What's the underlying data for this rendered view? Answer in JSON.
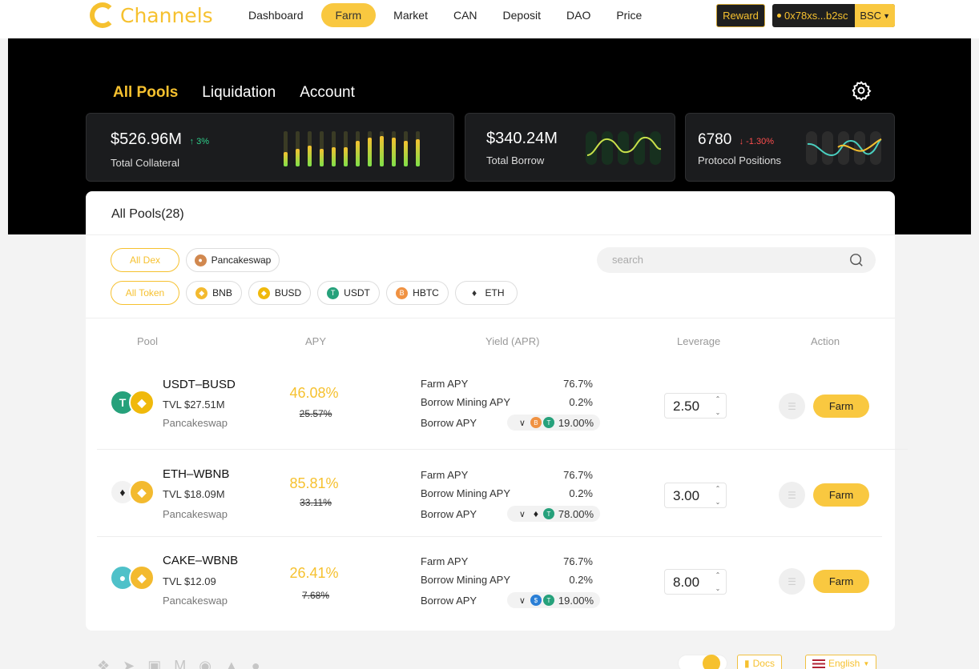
{
  "app": {
    "logo_text": "Channels"
  },
  "nav": {
    "items": [
      {
        "label": "Dashboard",
        "active": false
      },
      {
        "label": "Farm",
        "active": true
      },
      {
        "label": "Market",
        "active": false
      },
      {
        "label": "CAN",
        "active": false
      },
      {
        "label": "Deposit",
        "active": false
      },
      {
        "label": "DAO",
        "active": false
      },
      {
        "label": "Price",
        "active": false
      }
    ],
    "reward_label": "Reward",
    "wallet_address": "0x78xs...b2sc",
    "network": "BSC"
  },
  "hero": {
    "tabs": [
      "All Pools",
      "Liquidation",
      "Account"
    ],
    "active_tab": "All Pools"
  },
  "stats": [
    {
      "value": "$526.96M",
      "change": "3%",
      "direction": "up",
      "label": "Total Collateral"
    },
    {
      "value": "$340.24M",
      "change": "",
      "direction": "",
      "label": "Total Borrow"
    },
    {
      "value": "6780",
      "change": "-1.30%",
      "direction": "down",
      "label": "Protocol Positions"
    }
  ],
  "pools": {
    "title": "All Pools(28)",
    "dex_filters": [
      "All Dex",
      "Pancakeswap"
    ],
    "token_filters": [
      "All Token",
      "BNB",
      "BUSD",
      "USDT",
      "HBTC",
      "ETH"
    ],
    "search_placeholder": "search",
    "columns": [
      "Pool",
      "APY",
      "Yield (APR)",
      "Leverage",
      "Action"
    ],
    "yield_labels": [
      "Farm APY",
      "Borrow Mining APY",
      "Borrow APY"
    ],
    "action_label": "Farm",
    "rows": [
      {
        "name": "USDT–BUSD",
        "tvl": "TVL $27.51M",
        "dex": "Pancakeswap",
        "apy": "46.08%",
        "apy_old": "25.57%",
        "farm_apy": "76.7%",
        "mining_apy": "0.2%",
        "borrow_apy": "19.00%",
        "leverage": "2.50"
      },
      {
        "name": "ETH–WBNB",
        "tvl": "TVL $18.09M",
        "dex": "Pancakeswap",
        "apy": "85.81%",
        "apy_old": "33.11%",
        "farm_apy": "76.7%",
        "mining_apy": "0.2%",
        "borrow_apy": "78.00%",
        "leverage": "3.00"
      },
      {
        "name": "CAKE–WBNB",
        "tvl": "TVL $12.09",
        "dex": "Pancakeswap",
        "apy": "26.41%",
        "apy_old": "7.68%",
        "farm_apy": "76.7%",
        "mining_apy": "0.2%",
        "borrow_apy": "19.00%",
        "leverage": "8.00"
      }
    ]
  },
  "footer": {
    "docs_label": "Docs",
    "language": "English"
  },
  "colors": {
    "accent": "#f9c840",
    "up": "#2fd08b",
    "down": "#ff4d4d"
  }
}
